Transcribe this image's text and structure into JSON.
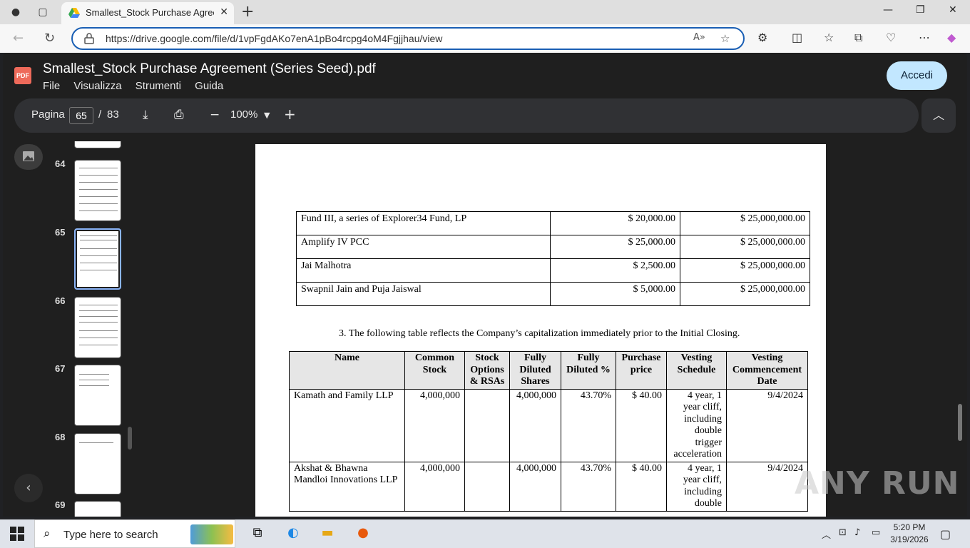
{
  "browser": {
    "tab_title": "Smallest_Stock Purchase Agreeme",
    "url": "https://drive.google.com/file/d/1vpFgdAKo7enA1pBo4rcpg4oM4Fgjjhau/view"
  },
  "viewer": {
    "pdf_badge": "PDF",
    "title": "Smallest_Stock Purchase Agreement (Series Seed).pdf",
    "menu": [
      "File",
      "Visualizza",
      "Strumenti",
      "Guida"
    ],
    "signin_label": "Accedi",
    "page_label": "Pagina",
    "current_page": "65",
    "page_separator": "/",
    "total_pages": "83",
    "zoom": "100%"
  },
  "thumbnails": [
    {
      "num": "64"
    },
    {
      "num": "65"
    },
    {
      "num": "66"
    },
    {
      "num": "67"
    },
    {
      "num": "68"
    },
    {
      "num": "69"
    }
  ],
  "document": {
    "investors_table": [
      {
        "name": "Fund III, a series of Explorer34 Fund, LP",
        "amount": "$ 20,000.00",
        "valuation": "$ 25,000,000.00"
      },
      {
        "name": "Amplify IV PCC",
        "amount": "$ 25,000.00",
        "valuation": "$ 25,000,000.00"
      },
      {
        "name": "Jai Malhotra",
        "amount": "$ 2,500.00",
        "valuation": "$ 25,000,000.00"
      },
      {
        "name": "Swapnil Jain and Puja Jaiswal",
        "amount": "$ 5,000.00",
        "valuation": "$ 25,000,000.00"
      }
    ],
    "cap_paragraph": "3.   The following table reflects the Company’s capitalization immediately prior to the Initial Closing.",
    "cap_headers": [
      "Name",
      "Common Stock",
      "Stock Options & RSAs",
      "Fully Diluted Shares",
      "Fully Diluted %",
      "Purchase price",
      "Vesting Schedule",
      "Vesting Commencement Date"
    ],
    "cap_rows": [
      {
        "name": "Kamath and Family LLP",
        "common": "4,000,000",
        "options": "",
        "fd_shares": "4,000,000",
        "fd_pct": "43.70%",
        "price": "$ 40.00",
        "vesting": "4 year, 1 year cliff, including double trigger acceleration",
        "date": "9/4/2024"
      },
      {
        "name": "Akshat & Bhawna Mandloi Innovations LLP",
        "common": "4,000,000",
        "options": "",
        "fd_shares": "4,000,000",
        "fd_pct": "43.70%",
        "price": "$ 40.00",
        "vesting": "4 year, 1 year cliff, including double",
        "date": "9/4/2024"
      }
    ]
  },
  "watermark": "ANY RUN",
  "taskbar": {
    "search_placeholder": "Type here to search",
    "time": "5:20 PM",
    "date": "3/19/2026"
  }
}
